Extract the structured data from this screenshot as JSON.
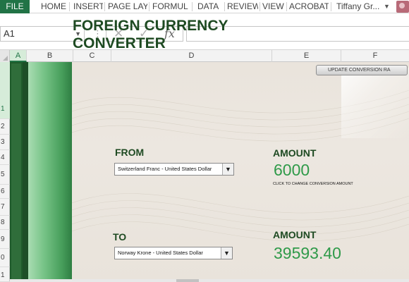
{
  "ribbon": {
    "file": "FILE",
    "tabs": [
      "HOME",
      "INSERT",
      "PAGE LAY",
      "FORMUL",
      "DATA",
      "REVIEW",
      "VIEW",
      "ACROBAT"
    ],
    "user": "Tiffany Gr...",
    "accent_color": "#217346"
  },
  "formula_bar": {
    "name_box": "A1",
    "cancel_icon": "cancel-x-icon",
    "enter_icon": "check-icon",
    "fx_label": "fx",
    "formula": ""
  },
  "columns": [
    "A",
    "B",
    "C",
    "D",
    "E",
    "F"
  ],
  "rows": [
    "1",
    "2",
    "3",
    "4",
    "5",
    "6",
    "7",
    "8",
    "9",
    "0",
    "1"
  ],
  "sheet": {
    "title_line1": "FOREIGN CURRENCY",
    "title_line2": "CONVERTER",
    "update_button": "UPDATE CONVERSION RA",
    "from_label": "FROM",
    "from_selected": "Switzerland Franc - United States Dollar",
    "amount_label_top": "AMOUNT",
    "amount_value": "6000",
    "amount_hint": "CLICK TO CHANGE CONVERSION AMOUNT",
    "to_label": "TO",
    "to_selected": "Norway Krone - United States Dollar",
    "amount_label_bottom": "AMOUNT",
    "converted_value": "39593.40",
    "title_color": "#1e4a22",
    "value_color": "#2f9a49"
  }
}
